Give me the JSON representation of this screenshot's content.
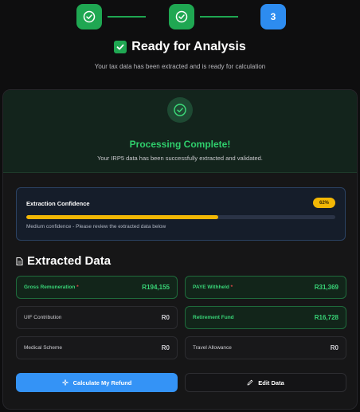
{
  "stepper": {
    "steps": [
      {
        "status": "done",
        "icon": "check-circle-icon"
      },
      {
        "status": "done",
        "icon": "check-circle-icon"
      },
      {
        "status": "current",
        "label": "3"
      }
    ]
  },
  "header": {
    "title": "Ready for Analysis",
    "subtitle": "Your tax data has been extracted and is ready for calculation"
  },
  "status": {
    "title": "Processing Complete!",
    "message": "Your IRP5 data has been successfully extracted and validated."
  },
  "confidence": {
    "label": "Extraction Confidence",
    "badge": "62%",
    "level": 0.62,
    "note": "Medium confidence - Please review the extracted data below"
  },
  "extracted": {
    "title": "Extracted Data",
    "fields": [
      {
        "label": "Gross Remuneration",
        "required": "*",
        "value": "R194,155"
      },
      {
        "label": "PAYE Withheld",
        "required": "*",
        "value": "R31,369"
      },
      {
        "label": "UIF Contribution",
        "value": "R0"
      },
      {
        "label": "Retirement Fund",
        "value": "R16,728"
      },
      {
        "label": "Medical Scheme",
        "value": "R0"
      },
      {
        "label": "Travel Allowance",
        "value": "R0"
      }
    ]
  },
  "actions": {
    "calculate_label": "Calculate My Refund",
    "edit_label": "Edit Data"
  },
  "colors": {
    "success": "#1fa752",
    "primary": "#2d8cf0",
    "warning": "#f2b705"
  }
}
